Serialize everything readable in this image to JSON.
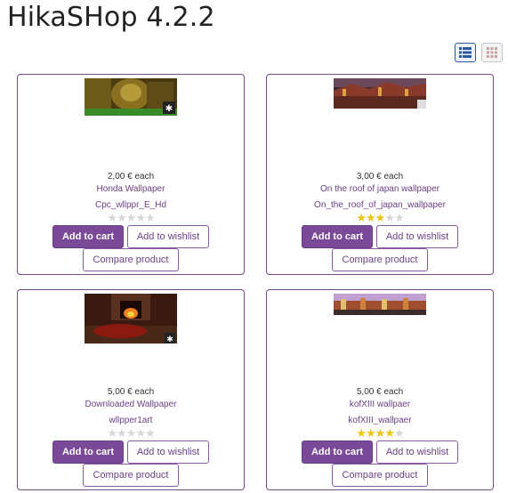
{
  "page": {
    "title": "HikaSHop 4.2.2"
  },
  "view_toggle": {
    "list_icon": "list-view-icon",
    "grid_icon": "grid-view-icon"
  },
  "products": [
    {
      "price": "2,00 € each",
      "name": "Honda Wallpaper",
      "code": "Cpc_wllppr_E_Hd",
      "rating": 0,
      "add_to_cart": "Add to cart",
      "add_to_wishlist": "Add to wishlist",
      "compare": "Compare product"
    },
    {
      "price": "3,00 € each",
      "name": "On the roof of japan wallpaper",
      "code": "On_the_roof_of_japan_wallpaper",
      "rating": 3,
      "add_to_cart": "Add to cart",
      "add_to_wishlist": "Add to wishlist",
      "compare": "Compare product"
    },
    {
      "price": "5,00 € each",
      "name": "Downloaded Wallpaper",
      "code": "wllpper1art",
      "rating": 0,
      "add_to_cart": "Add to cart",
      "add_to_wishlist": "Add to wishlist",
      "compare": "Compare product"
    },
    {
      "price": "5,00 € each",
      "name": "kofXIII wallpaer",
      "code": "kofXIII_wallpaer",
      "rating": 4,
      "add_to_cart": "Add to cart",
      "add_to_wishlist": "Add to wishlist",
      "compare": "Compare product"
    }
  ],
  "colors": {
    "accent": "#7a4a98",
    "link": "#6b3f87",
    "star_on": "#f0c419",
    "star_off": "#d7d7d7"
  }
}
